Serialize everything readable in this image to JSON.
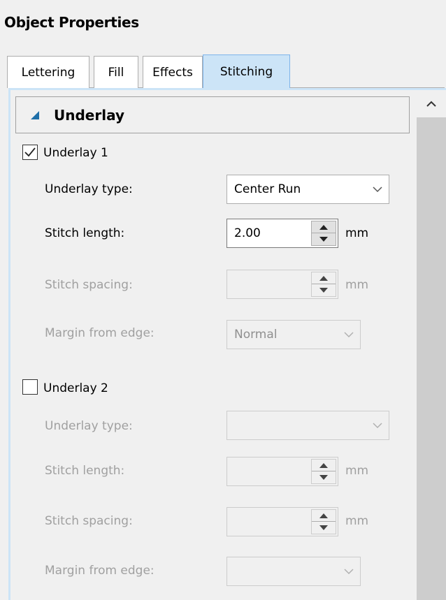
{
  "panel": {
    "title": "Object Properties"
  },
  "tabs": [
    {
      "label": "Lettering",
      "active": false
    },
    {
      "label": "Fill",
      "active": false
    },
    {
      "label": "Effects",
      "active": false
    },
    {
      "label": "Stitching",
      "active": true
    }
  ],
  "section": {
    "title": "Underlay",
    "expanded": true,
    "icon": "triangle-collapse-icon"
  },
  "underlay1": {
    "label": "Underlay 1",
    "checked": true,
    "type_label": "Underlay type:",
    "type_value": "Center Run",
    "stitch_length_label": "Stitch length:",
    "stitch_length_value": "2.00",
    "stitch_length_unit": "mm",
    "stitch_spacing_label": "Stitch spacing:",
    "stitch_spacing_value": "",
    "stitch_spacing_unit": "mm",
    "margin_label": "Margin from edge:",
    "margin_value": "Normal"
  },
  "underlay2": {
    "label": "Underlay 2",
    "checked": false,
    "type_label": "Underlay type:",
    "type_value": "",
    "stitch_length_label": "Stitch length:",
    "stitch_length_value": "",
    "stitch_length_unit": "mm",
    "stitch_spacing_label": "Stitch spacing:",
    "stitch_spacing_value": "",
    "stitch_spacing_unit": "mm",
    "margin_label": "Margin from edge:",
    "margin_value": ""
  },
  "colors": {
    "active_tab": "#cce4f7",
    "active_tab_border": "#7eb4ea",
    "section_arrow": "#1e6fa8",
    "disabled_text": "#a0a0a0"
  }
}
